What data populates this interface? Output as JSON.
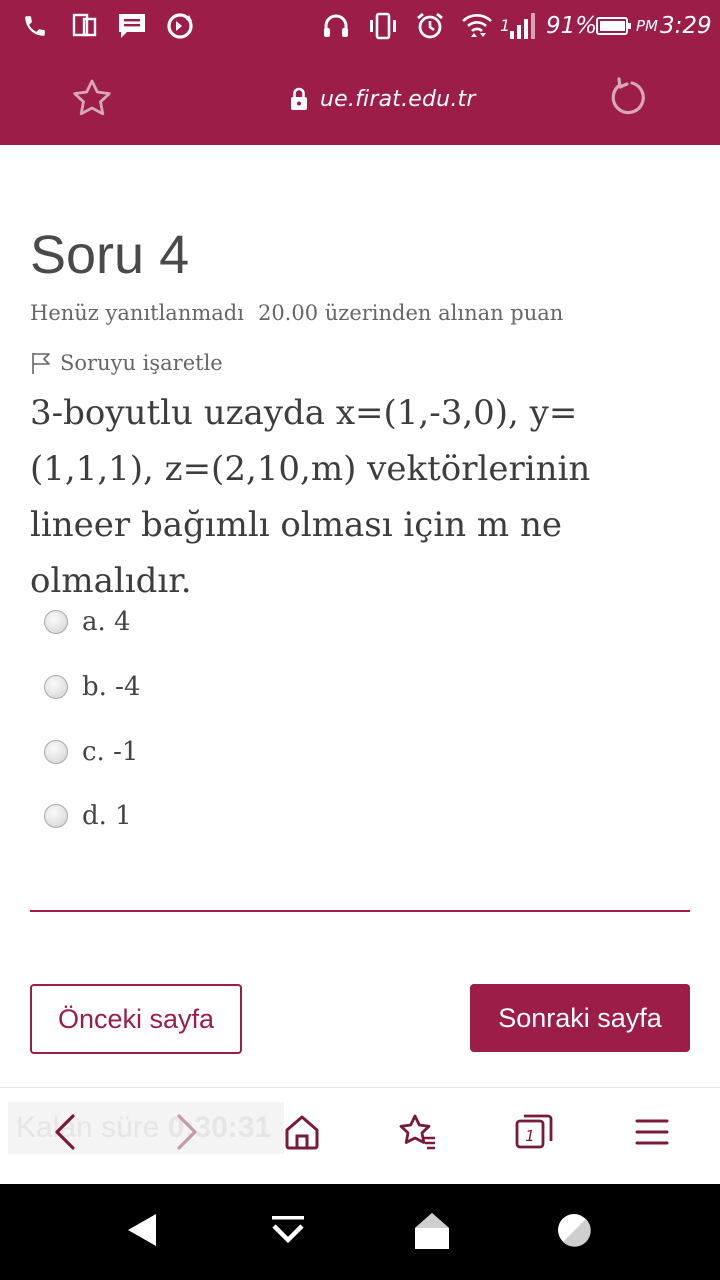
{
  "colors": {
    "brand": "#9c1d48",
    "text_dark": "#3d3d3d",
    "text_muted": "#666666"
  },
  "status_bar": {
    "icons": [
      "phone-icon",
      "dual-screen-icon",
      "message-icon",
      "sync-icon",
      "headset-icon",
      "vibrate-icon",
      "alarm-icon",
      "wifi-icon",
      "signal-icon",
      "battery-icon"
    ],
    "signal_label": "1",
    "battery": "91%",
    "ampm": "PM",
    "time": "3:29"
  },
  "url_bar": {
    "url": "ue.firat.edu.tr",
    "star_icon": "star-icon",
    "lock_icon": "lock-icon",
    "reload_icon": "reload-icon"
  },
  "question": {
    "title": "Soru 4",
    "status": "Henüz yanıtlanmadı",
    "points": "20.00 üzerinden alınan puan",
    "flag_label": "Soruyu işaretle",
    "text": "3-boyutlu uzayda x=(1,-3,0), y=(1,1,1), z=(2,10,m) vektörlerinin lineer bağımlı olması için m ne olmalıdır.",
    "answers": [
      {
        "label": "a. 4"
      },
      {
        "label": "b. -4"
      },
      {
        "label": "c. -1"
      },
      {
        "label": "d. 1"
      }
    ]
  },
  "navigation": {
    "prev_label": "Önceki sayfa",
    "next_label": "Sonraki sayfa"
  },
  "timer": {
    "label": "Kalan süre",
    "value": "0:30:31"
  },
  "browser_bar": {
    "tabs_count": "1",
    "icons": [
      "back-icon",
      "forward-icon",
      "home-icon",
      "bookmarks-icon",
      "tabs-icon",
      "menu-icon"
    ]
  },
  "system_nav": {
    "icons": [
      "back-triangle-icon",
      "hide-keyboard-icon",
      "home-pentagon-icon",
      "recents-circle-icon"
    ]
  }
}
